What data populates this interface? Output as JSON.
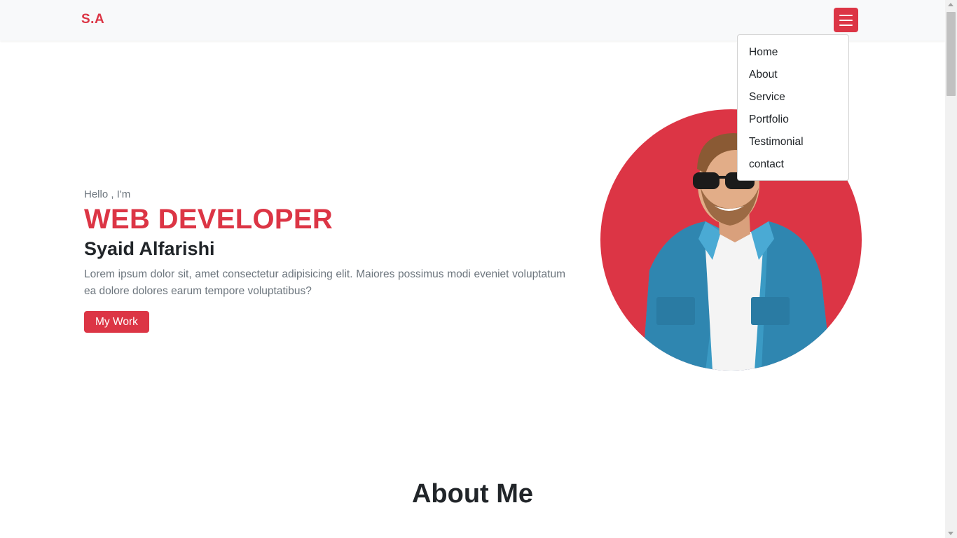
{
  "navbar": {
    "brand": "S.A",
    "toggler_icon": "hamburger-icon"
  },
  "menu": {
    "items": [
      "Home",
      "About",
      "Service",
      "Portfolio",
      "Testimonial",
      "contact"
    ]
  },
  "hero": {
    "greeting": "Hello , I'm",
    "role": "WEB DEVELOPER",
    "name": "Syaid Alfarishi",
    "description": "Lorem ipsum dolor sit, amet consectetur adipisicing elit. Maiores possimus modi eveniet voluptatum ea dolore dolores earum tempore voluptatibus?",
    "button_label": "My Work"
  },
  "about": {
    "title": "About Me"
  },
  "colors": {
    "accent": "#dc3545",
    "navbar_bg": "#f8f9fa",
    "text_muted": "#6c757d"
  }
}
